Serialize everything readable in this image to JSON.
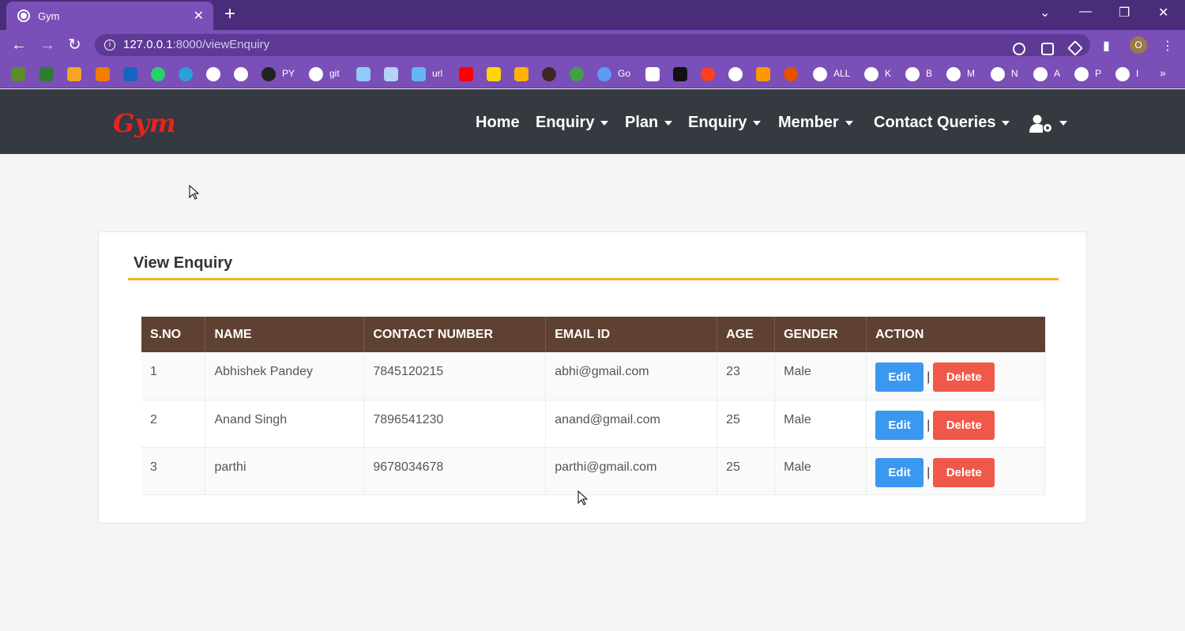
{
  "browser": {
    "tab_title": "Gym",
    "url_host": "127.0.0.1",
    "url_path": ":8000/viewEnquiry",
    "profile_initial": "O",
    "bookmark_labels": [
      "PY",
      "git",
      "url",
      "Go",
      "ALL",
      "K",
      "B",
      "M",
      "N",
      "A",
      "P",
      "I"
    ]
  },
  "navbar": {
    "brand": "Gym",
    "items": [
      {
        "label": "Home"
      },
      {
        "label": "Enquiry"
      },
      {
        "label": "Plan"
      },
      {
        "label": "Enquiry"
      },
      {
        "label": "Member"
      },
      {
        "label": "Contact Queries"
      }
    ]
  },
  "card": {
    "title": "View Enquiry"
  },
  "table": {
    "headers": [
      "S.NO",
      "NAME",
      "CONTACT NUMBER",
      "EMAIL ID",
      "AGE",
      "GENDER",
      "ACTION"
    ],
    "rows": [
      {
        "sno": "1",
        "name": "Abhishek Pandey",
        "contact": "7845120215",
        "email": "abhi@gmail.com",
        "age": "23",
        "gender": "Male"
      },
      {
        "sno": "2",
        "name": "Anand Singh",
        "contact": "7896541230",
        "email": "anand@gmail.com",
        "age": "25",
        "gender": "Male"
      },
      {
        "sno": "3",
        "name": "parthi",
        "contact": "9678034678",
        "email": "parthi@gmail.com",
        "age": "25",
        "gender": "Male"
      }
    ],
    "edit_label": "Edit",
    "delete_label": "Delete",
    "separator": "|"
  },
  "colors": {
    "header_bg": "#5e4132",
    "accent_rule": "#f0b429",
    "edit": "#3a98f0",
    "delete": "#f0584a",
    "navbar": "#343a40",
    "browser": "#7a4fb8"
  }
}
